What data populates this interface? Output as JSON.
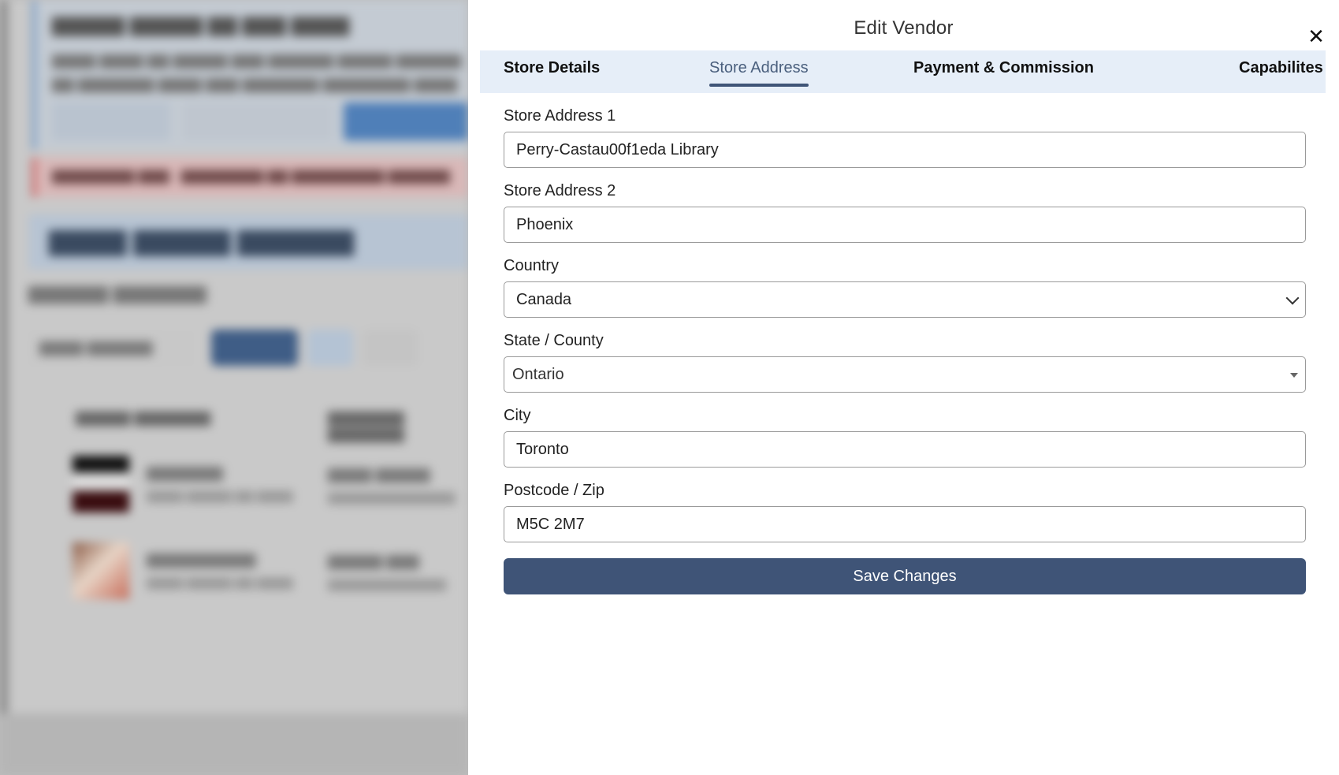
{
  "modal": {
    "title": "Edit Vendor",
    "close_icon": "close-icon"
  },
  "tabs": [
    {
      "label": "Store Details",
      "active": false
    },
    {
      "label": "Store Address",
      "active": true
    },
    {
      "label": "Payment & Commission",
      "active": false
    },
    {
      "label": "Capabilites",
      "active": false
    }
  ],
  "form": {
    "store_address_1": {
      "label": "Store Address 1",
      "value": "Perry-Castau00f1eda Library"
    },
    "store_address_2": {
      "label": "Store Address 2",
      "value": "Phoenix"
    },
    "country": {
      "label": "Country",
      "value": "Canada"
    },
    "state": {
      "label": "State / County",
      "value": "Ontario"
    },
    "city": {
      "label": "City",
      "value": "Toronto"
    },
    "postcode": {
      "label": "Postcode / Zip",
      "value": "M5C 2M7"
    }
  },
  "save_button": {
    "label": "Save Changes"
  },
  "colors": {
    "accent": "#3f5477",
    "tabs_background": "#e6eef8",
    "drawer_background": "#ffffff"
  }
}
